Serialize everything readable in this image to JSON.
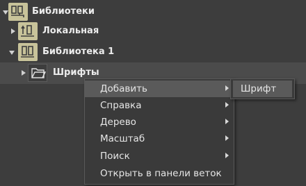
{
  "tree": {
    "items": [
      {
        "label": "Библиотеки",
        "expanded": true,
        "icon": "libraries-icon"
      },
      {
        "label": "Локальная",
        "expanded": false,
        "icon": "local-library-icon"
      },
      {
        "label": "Библиотека 1",
        "expanded": true,
        "icon": "library-icon"
      },
      {
        "label": "Шрифты",
        "expanded": false,
        "icon": "folder-icon",
        "selected": true
      }
    ]
  },
  "context_menu": {
    "items": [
      {
        "label": "Добавить",
        "has_submenu": true,
        "active": true
      },
      {
        "label": "Справка",
        "has_submenu": true
      },
      {
        "label": "Дерево",
        "has_submenu": true
      },
      {
        "label": "Масштаб",
        "has_submenu": true
      },
      {
        "label": "Поиск",
        "has_submenu": true
      },
      {
        "label": "Открыть в панели веток",
        "has_submenu": false
      }
    ]
  },
  "submenu": {
    "items": [
      {
        "label": "Шрифт"
      }
    ]
  },
  "colors": {
    "background": "#3d3d3d",
    "icon_fill": "#c8c39a",
    "menu_highlight": "#5a5a5a"
  }
}
